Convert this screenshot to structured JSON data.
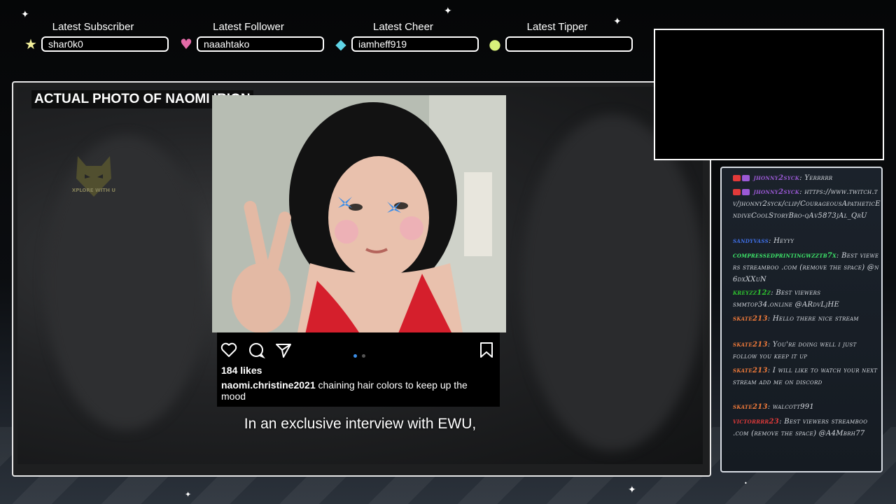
{
  "alerts": [
    {
      "label": "Latest Subscriber",
      "value": "shar0k0",
      "icon": "star-icon",
      "icon_color": "#f3f19b"
    },
    {
      "label": "Latest Follower",
      "value": "naaahtako",
      "icon": "heart-icon",
      "icon_color": "#e46ba8"
    },
    {
      "label": "Latest Cheer",
      "value": "iamheff919",
      "icon": "gem-icon",
      "icon_color": "#5fd4e6"
    },
    {
      "label": "Latest Tipper",
      "value": "",
      "icon": "coin-icon",
      "icon_color": "#d7f07a"
    }
  ],
  "video": {
    "banner": "ACTUAL PHOTO OF NAOMI IRION",
    "subtitle": "In an exclusive interview with EWU,",
    "logo_text": "EXPLORE WITH US"
  },
  "instagram": {
    "likes": "184 likes",
    "username": "naomi.christine2021",
    "caption": "chaining hair colors to keep up the mood"
  },
  "chat": {
    "messages": [
      {
        "user": "jhonny2syck",
        "user_color": "#9b59d6",
        "text": "Yerrrrr",
        "badges": true
      },
      {
        "user": "jhonny2syck",
        "user_color": "#9b59d6",
        "text": "https://www.twitch.tv/jhonny2syck/clip/CourageousApatheticEndiveCoolStoryBro-qAv5873jAl_QrU",
        "badges": true
      },
      {
        "user": "sandyvass",
        "user_color": "#3f6fe8",
        "text": "Heyyy",
        "badges": false
      },
      {
        "user": "compressedprintingwzztb7x",
        "user_color": "#3ee86a",
        "text": "Best viewers streamboo .com (remove the space) @n6dxXXuN",
        "badges": false
      },
      {
        "user": "kreyzz12z",
        "user_color": "#2fc62f",
        "text": "Best viewers smmtop34.online @ARdvLjHE",
        "badges": false
      },
      {
        "user": "skate213",
        "user_color": "#f07a3a",
        "text": "Hello there nice stream",
        "badges": false
      },
      {
        "user": "skate213",
        "user_color": "#f07a3a",
        "text": "You're doing well i just follow you keep it up",
        "badges": false
      },
      {
        "user": "skate213",
        "user_color": "#f07a3a",
        "text": "I will like to watch your next stream add me on discord",
        "badges": false
      },
      {
        "user": "skate213",
        "user_color": "#f07a3a",
        "text": "walcott991",
        "badges": false
      },
      {
        "user": "victorrrr23",
        "user_color": "#e23a3a",
        "text": "Best viewers streamboo .com (remove the space) @A4Mbrh77",
        "badges": false
      }
    ]
  }
}
